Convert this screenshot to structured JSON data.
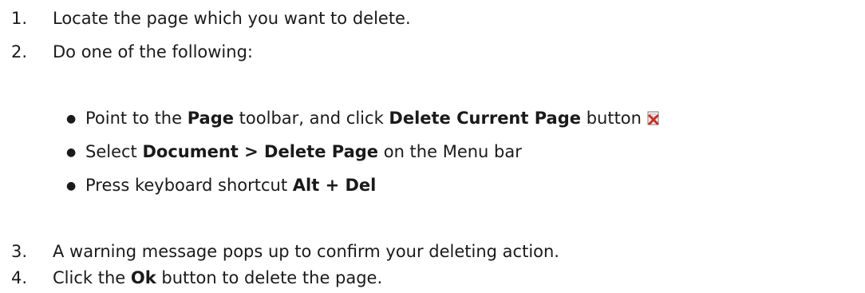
{
  "steps": [
    {
      "num": "1.",
      "text": "Locate the page which you want to delete."
    },
    {
      "num": "2.",
      "text": "Do one of the following:"
    },
    {
      "num": "3.",
      "text": "A warning message pops up to confirm your deleting action."
    },
    {
      "num": "4.",
      "pre": "Click the ",
      "bold": "Ok",
      "post": " button to delete the page."
    }
  ],
  "options": [
    {
      "pre": "Point to the ",
      "bold1": "Page",
      "mid": " toolbar, and click ",
      "bold2": "Delete Current Page",
      "post": " button",
      "icon": "delete-page-icon"
    },
    {
      "pre": "Select ",
      "bold1": "Document > Delete Page",
      "post": " on the Menu bar"
    },
    {
      "pre": "Press keyboard shortcut ",
      "bold1": "Alt + Del"
    }
  ],
  "colors": {
    "icon_red": "#d42a1c",
    "icon_page": "#f4f4f4"
  }
}
